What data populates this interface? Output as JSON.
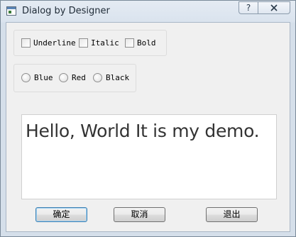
{
  "window": {
    "title": "Dialog by Designer",
    "help_symbol": "?"
  },
  "style_group": {
    "options": [
      {
        "label": "Underline",
        "checked": false
      },
      {
        "label": "Italic",
        "checked": false
      },
      {
        "label": "Bold",
        "checked": false
      }
    ]
  },
  "color_group": {
    "options": [
      {
        "label": "Blue",
        "selected": false
      },
      {
        "label": "Red",
        "selected": false
      },
      {
        "label": "Black",
        "selected": false
      }
    ]
  },
  "text_edit": {
    "value": "Hello, World It is my demo."
  },
  "buttons": {
    "ok_label": "确定",
    "cancel_label": "取消",
    "exit_label": "退出"
  },
  "colors": {
    "titlebar": "#dae3ee",
    "client_background": "#f0f0f0",
    "default_button_border": "#3c7fb1",
    "text_color": "#333333"
  }
}
